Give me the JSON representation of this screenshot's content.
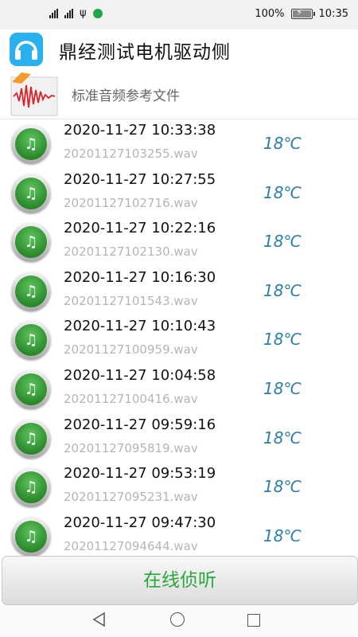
{
  "status": {
    "signal1": "4G",
    "signal2": "4G",
    "battery_percent": "100%",
    "battery_level": 1.0,
    "time": "10:35"
  },
  "app": {
    "title": "鼎经测试电机驱动侧"
  },
  "reference": {
    "label": "标准音频参考文件",
    "thumb_badge": "WAV"
  },
  "records": [
    {
      "time": "2020-11-27 10:33:38",
      "file": "20201127103255.wav",
      "temp": "18℃"
    },
    {
      "time": "2020-11-27 10:27:55",
      "file": "20201127102716.wav",
      "temp": "18℃"
    },
    {
      "time": "2020-11-27 10:22:16",
      "file": "20201127102130.wav",
      "temp": "18℃"
    },
    {
      "time": "2020-11-27 10:16:30",
      "file": "20201127101543.wav",
      "temp": "18℃"
    },
    {
      "time": "2020-11-27 10:10:43",
      "file": "20201127100959.wav",
      "temp": "18℃"
    },
    {
      "time": "2020-11-27 10:04:58",
      "file": "20201127100416.wav",
      "temp": "18℃"
    },
    {
      "time": "2020-11-27 09:59:16",
      "file": "20201127095819.wav",
      "temp": "18℃"
    },
    {
      "time": "2020-11-27 09:53:19",
      "file": "20201127095231.wav",
      "temp": "18℃"
    },
    {
      "time": "2020-11-27 09:47:30",
      "file": "20201127094644.wav",
      "temp": "18℃"
    }
  ],
  "actions": {
    "listen_label": "在线侦听"
  },
  "icons": {
    "record_icon": "music-note-icon",
    "note_glyph": "♫"
  },
  "colors": {
    "accent_green": "#26a83b",
    "temp_blue": "#2d7fa8",
    "app_icon_blue": "#2ab0ee"
  }
}
